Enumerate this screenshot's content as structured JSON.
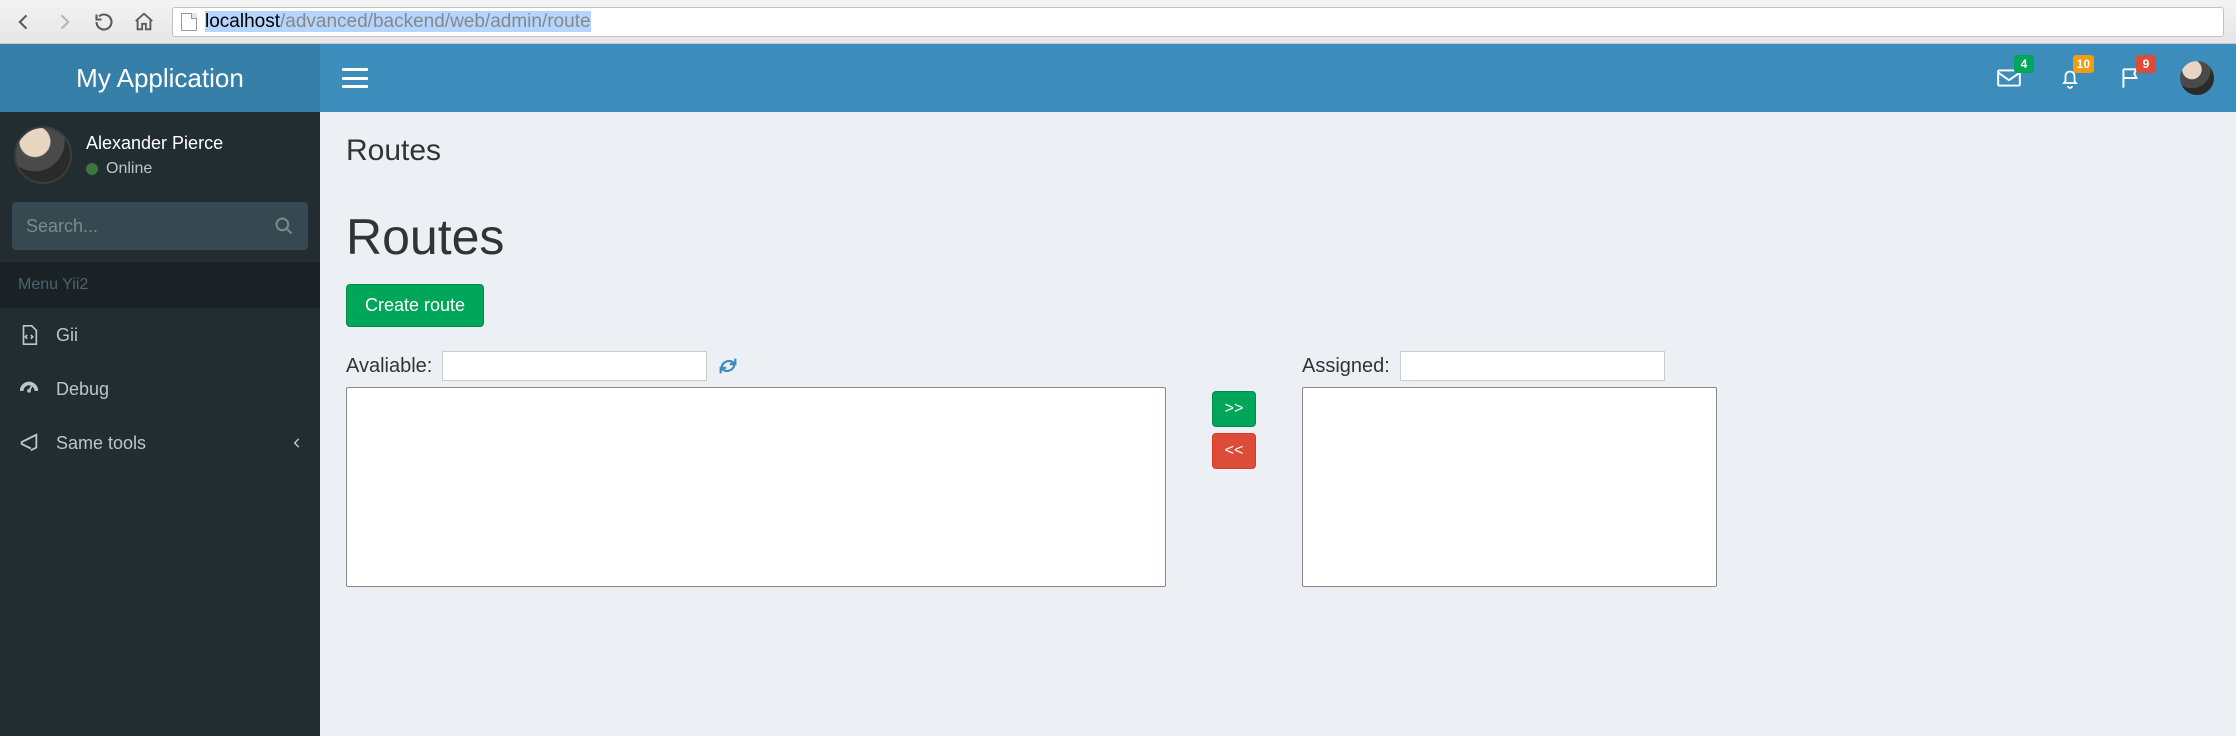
{
  "browser": {
    "url_host": "localhost",
    "url_path": "/advanced/backend/web/admin/route"
  },
  "brand": "My Application",
  "user": {
    "name": "Alexander Pierce",
    "status": "Online"
  },
  "search": {
    "placeholder": "Search..."
  },
  "menu_header": "Menu Yii2",
  "nav": {
    "gii": "Gii",
    "debug": "Debug",
    "same_tools": "Same tools"
  },
  "notifications": {
    "mail": "4",
    "bell": "10",
    "flag": "9"
  },
  "page": {
    "header_title": "Routes",
    "title": "Routes",
    "create_btn": "Create route",
    "available_label": "Avaliable:",
    "assigned_label": "Assigned:",
    "assign_btn": ">>",
    "revoke_btn": "<<"
  }
}
